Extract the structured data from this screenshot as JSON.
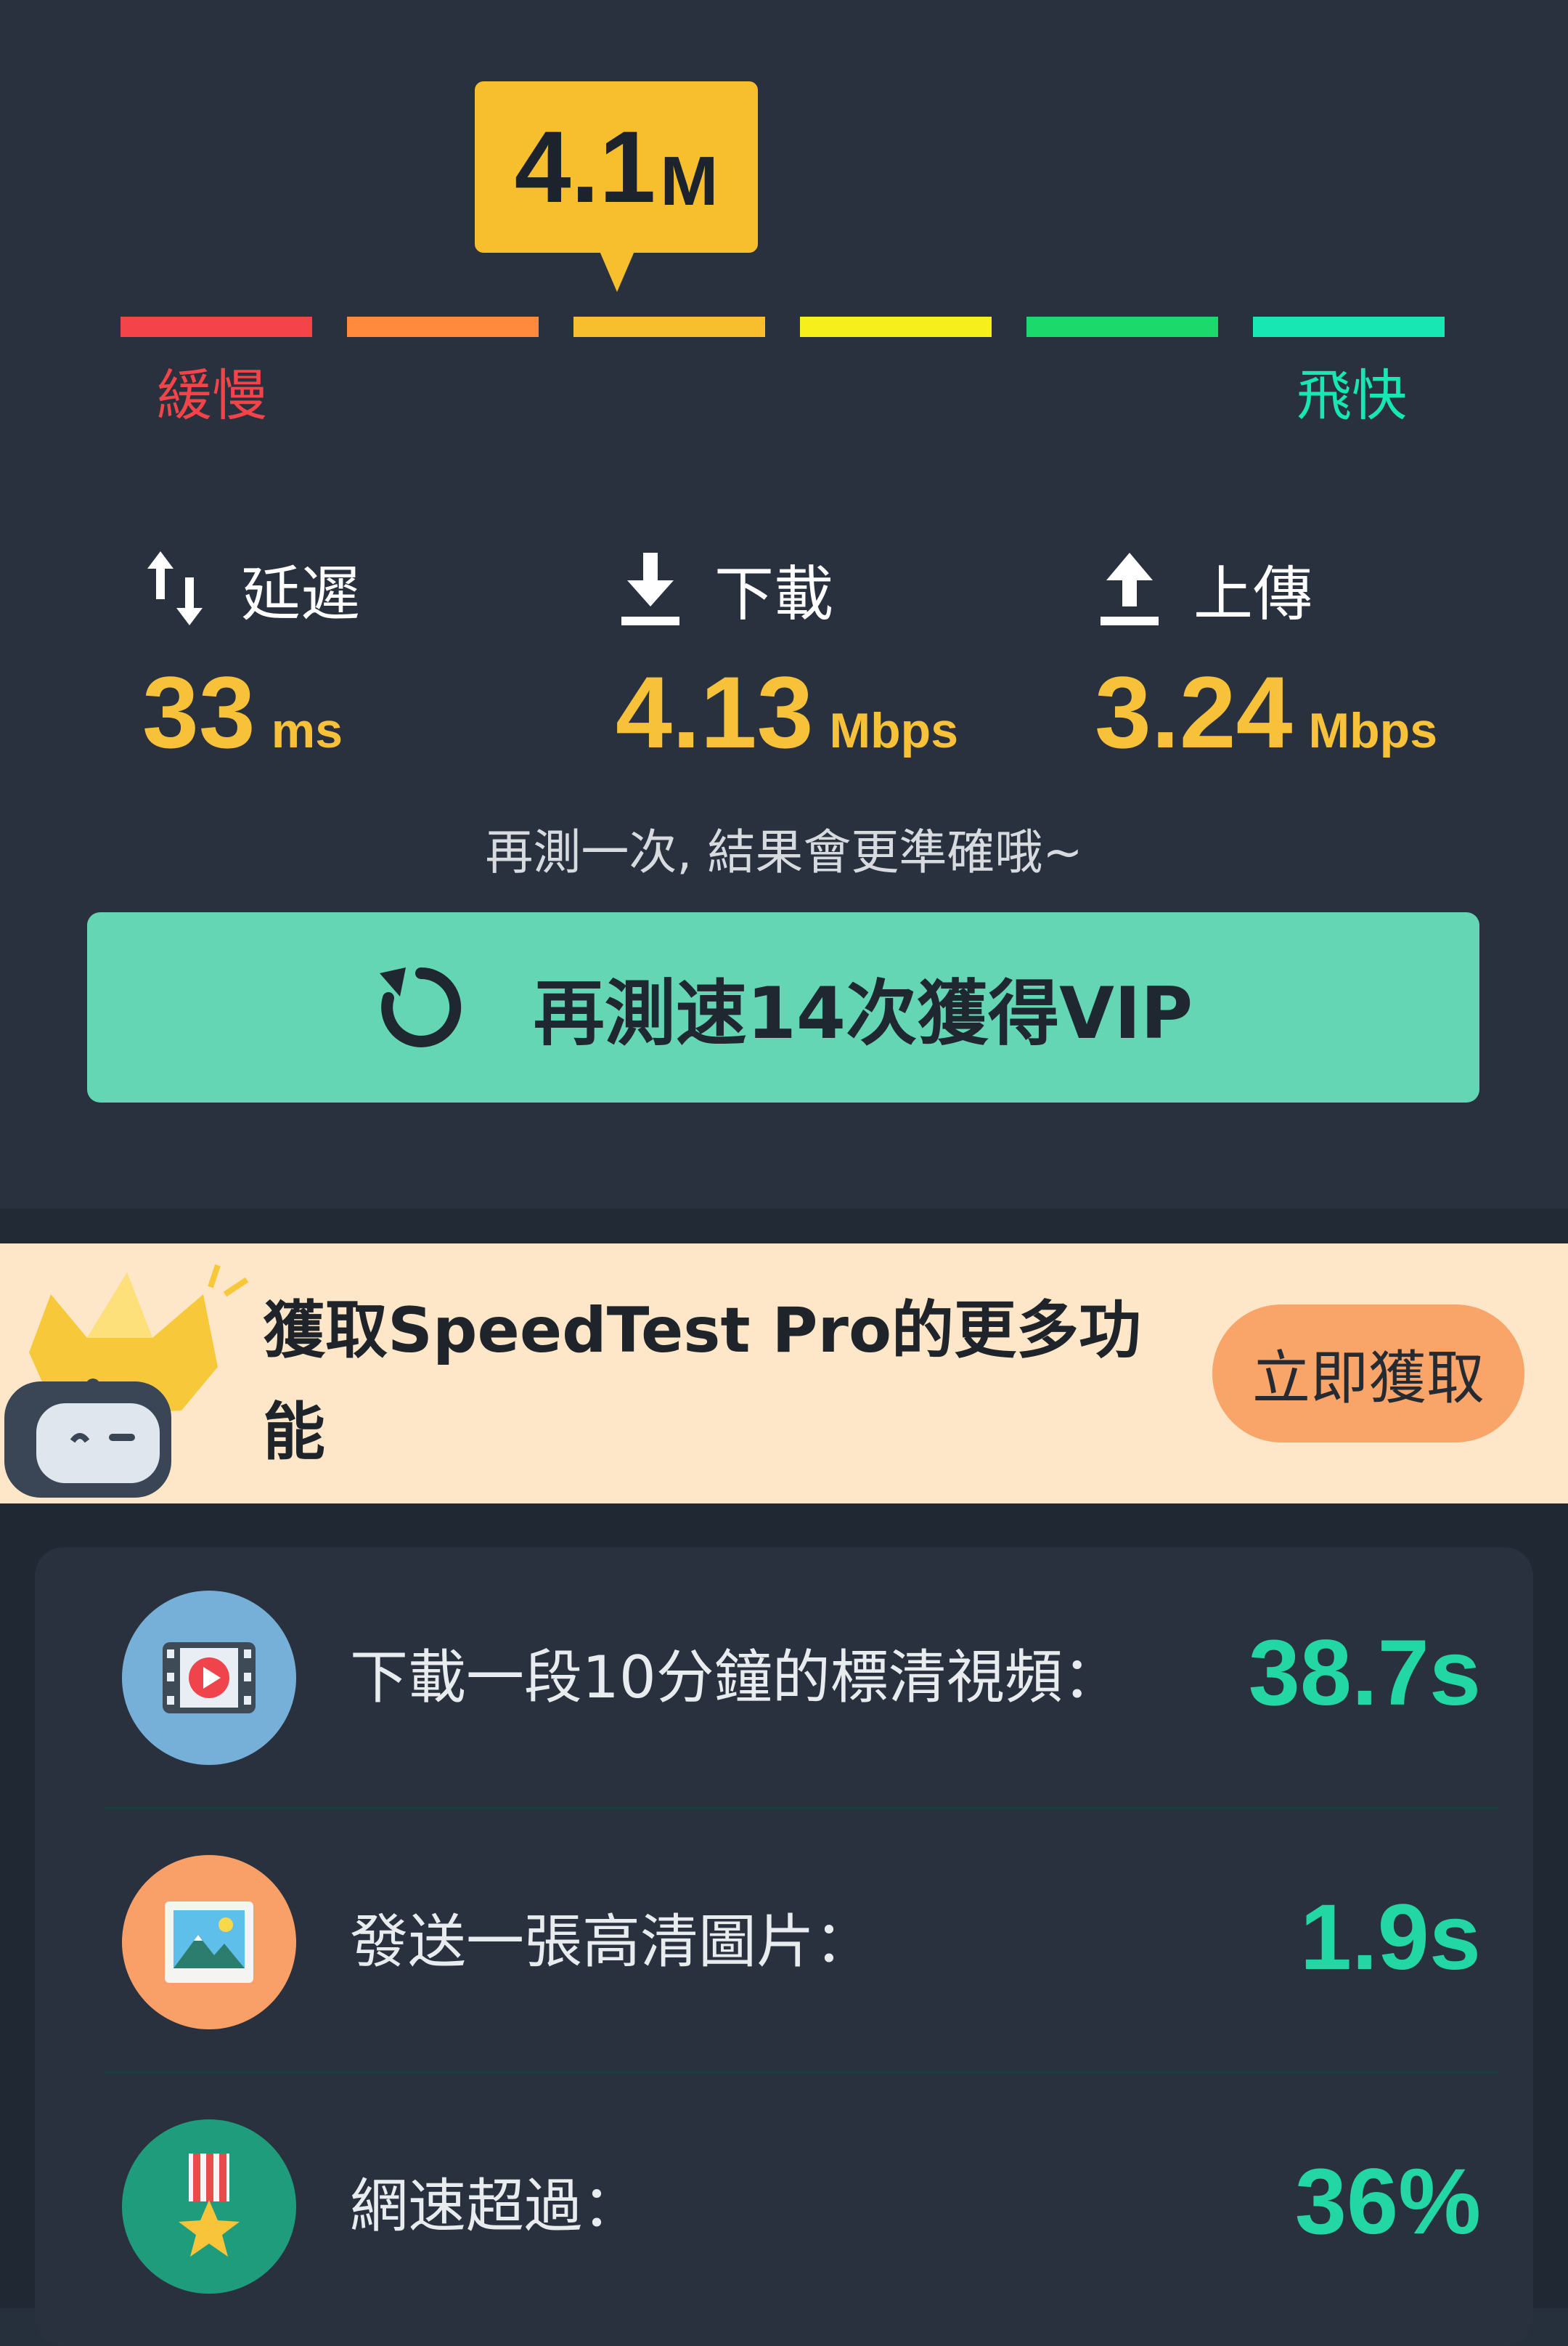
{
  "gauge": {
    "current_value": "4.1",
    "current_unit": "M",
    "slow_label": "緩慢",
    "fast_label": "飛快",
    "colors": [
      "#f5434a",
      "#ff8a3d",
      "#f7be2e",
      "#f7ef1c",
      "#1bd96a",
      "#17e7b2"
    ]
  },
  "metrics": {
    "latency": {
      "label": "延遲",
      "value": "33",
      "unit": "ms",
      "icon": "swap-vert-icon"
    },
    "download": {
      "label": "下載",
      "value": "4.13",
      "unit": "Mbps",
      "icon": "download-icon"
    },
    "upload": {
      "label": "上傳",
      "value": "3.24",
      "unit": "Mbps",
      "icon": "upload-icon"
    }
  },
  "hint": "再測一次, 結果會更準確哦~",
  "retest_button": {
    "label": "再測速14次獲得VIP",
    "icon": "refresh-icon"
  },
  "promo": {
    "text": "獲取SpeedTest Pro的更多功能",
    "button_label": "立即獲取"
  },
  "stats": [
    {
      "label": "下載一段10分鐘的標清視頻：",
      "value": "38.7s",
      "icon": "video-icon",
      "icon_bg": "#76afd7"
    },
    {
      "label": "發送一張高清圖片：",
      "value": "1.9s",
      "icon": "image-icon",
      "icon_bg": "#f99f68"
    },
    {
      "label": "網速超過：",
      "value": "36%",
      "icon": "medal-icon",
      "icon_bg": "#1f9c7c"
    }
  ]
}
